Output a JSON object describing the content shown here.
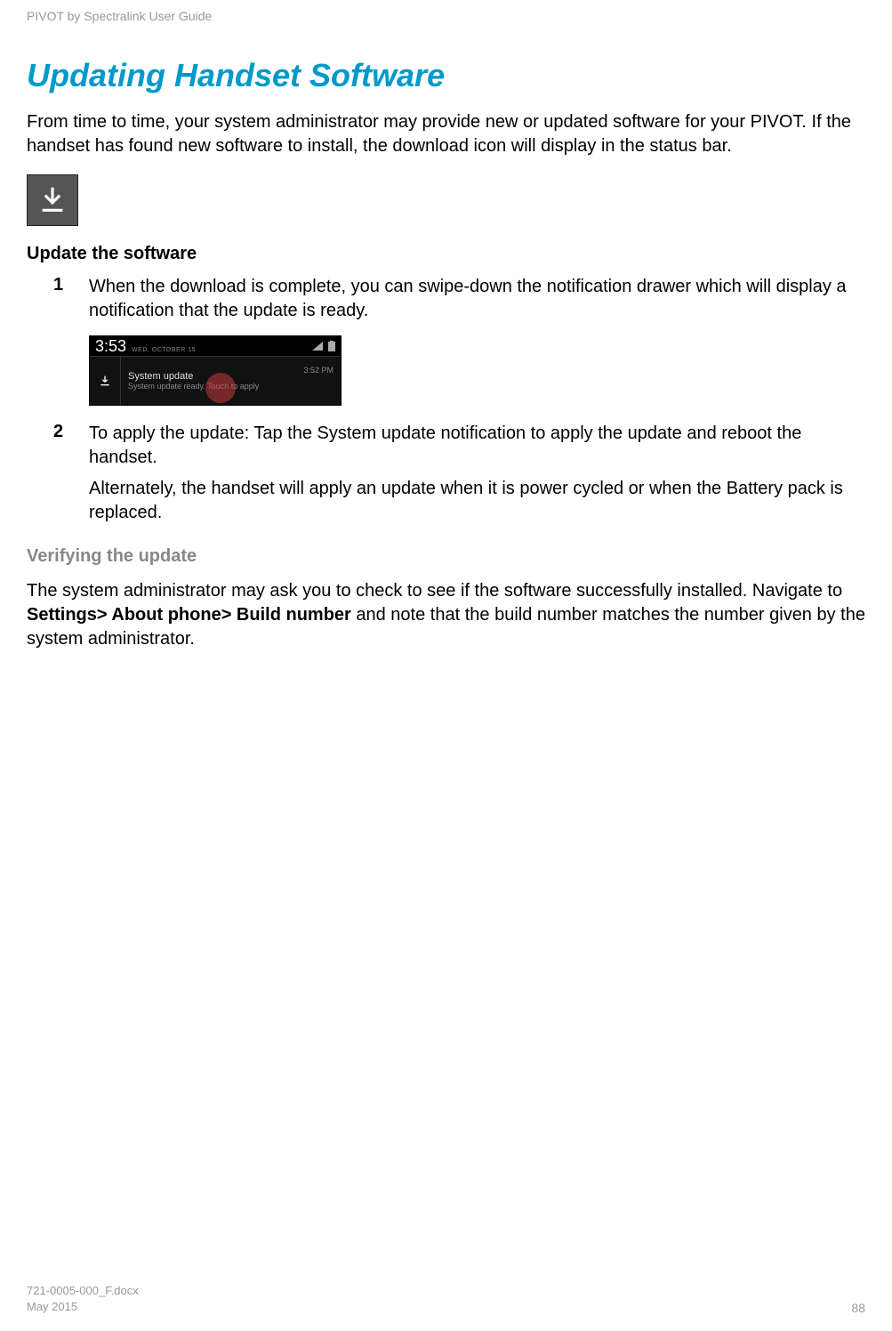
{
  "header": "PIVOT by Spectralink User Guide",
  "title": "Updating Handset Software",
  "intro": "From time to time, your system administrator may provide new or updated software for your PIVOT. If the handset has found new software to install, the download icon will display in the status bar.",
  "subheading": "Update the software",
  "steps": {
    "s1": {
      "num": "1",
      "text": "When the download is complete, you can swipe-down the notification drawer which will display a notification that the update is ready."
    },
    "s2": {
      "num": "2",
      "text": "To apply the update: Tap the System update notification to apply the update and reboot the handset.",
      "sub": "Alternately, the handset will apply an update when it is power cycled or when the Battery pack is replaced."
    }
  },
  "screenshot": {
    "time": "3:53",
    "date": "WED, OCTOBER 15",
    "notif_title": "System update",
    "notif_sub": "System update ready. Touch to apply",
    "notif_time": "3:52 PM"
  },
  "verify_heading": "Verifying the update",
  "verify_text_1": "The system administrator may ask you to check to see if the software successfully installed. Navigate to ",
  "verify_bold": "Settings> About phone> Build number",
  "verify_text_2": " and note that the build number matches the number given by the system administrator.",
  "footer": {
    "doc": "721-0005-000_F.docx",
    "date": "May 2015",
    "page": "88"
  }
}
